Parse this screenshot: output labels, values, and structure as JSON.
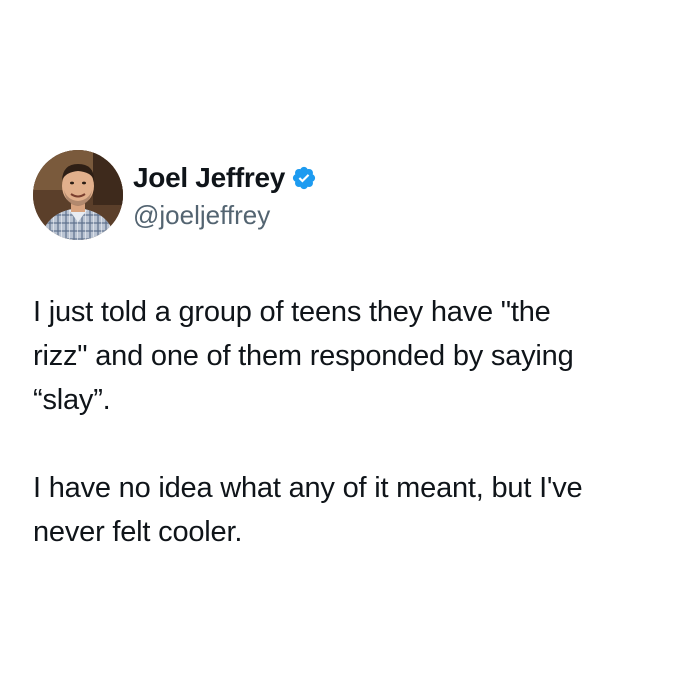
{
  "author": {
    "display_name": "Joel Jeffrey",
    "handle": "@joeljeffrey",
    "verified": true,
    "avatar_icon": "profile-photo-icon",
    "verified_icon": "verified-badge-icon",
    "accent_color": "#1d9bf0"
  },
  "tweet": {
    "paragraphs": [
      "I just told a group of teens they have \"the\nrizz\" and one of them responded by saying\n“slay”.",
      "I have no idea what any of it meant, but I've\nnever felt cooler."
    ]
  },
  "colors": {
    "background": "#ffffff",
    "text": "#0f1419",
    "secondary_text": "#536471"
  }
}
